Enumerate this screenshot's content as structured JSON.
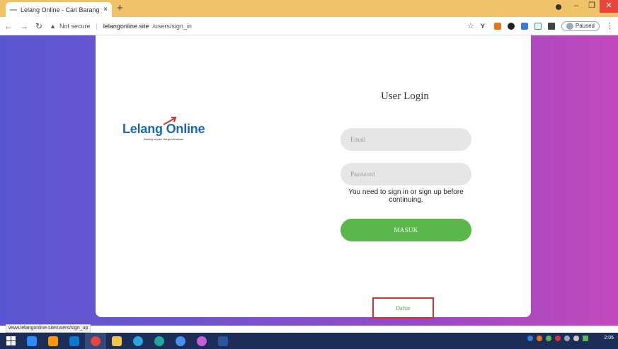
{
  "browser": {
    "tab_title": "Lelang Online - Cari Barang impi",
    "tab_close": "×",
    "new_tab": "+",
    "security_label": "Not secure",
    "url_host": "lelangonline.site",
    "url_path": "/users/sign_in",
    "profile_status": "Paused",
    "status_url": "www.lelangonline.site/users/sign_up"
  },
  "logo": {
    "brand": "Lelang Online",
    "tagline": "Barang Impian Harga Menawan"
  },
  "login": {
    "title": "User Login",
    "email_placeholder": "Email",
    "password_placeholder": "Password",
    "notice": "You need to sign in or sign up before continuing.",
    "submit_label": "MASUK",
    "register_label": "Daftar"
  },
  "taskbar": {
    "clock": "2:05"
  },
  "colors": {
    "primary_button": "#59b849",
    "brand_blue": "#1e67b8",
    "highlight_box": "#d63131",
    "tab_strip": "#f1c368",
    "taskbar": "#1c2e57"
  }
}
